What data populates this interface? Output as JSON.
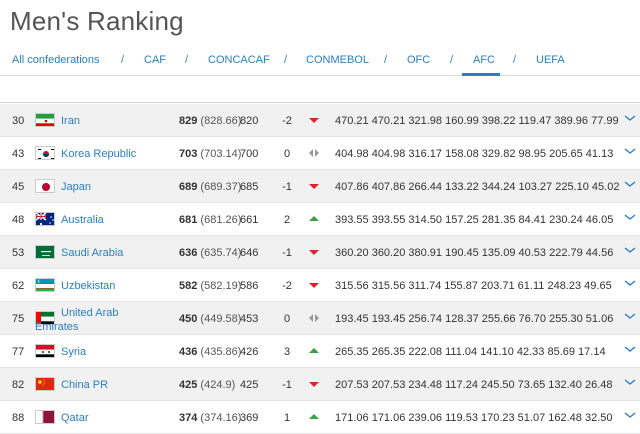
{
  "page": {
    "title": "Men's Ranking"
  },
  "tabs": [
    {
      "label": "All confederations",
      "active": false
    },
    {
      "label": "CAF",
      "active": false
    },
    {
      "label": "CONCACAF",
      "active": false
    },
    {
      "label": "CONMEBOL",
      "active": false
    },
    {
      "label": "OFC",
      "active": false
    },
    {
      "label": "AFC",
      "active": true
    },
    {
      "label": "UEFA",
      "active": false
    }
  ],
  "separator": "/",
  "colors": {
    "link": "#2a7fc0",
    "down": "#d9222a",
    "up": "#3aa146",
    "same": "#999999",
    "row_alt": "#f1f1f1"
  },
  "rows": [
    {
      "rank": "30",
      "country": "Iran",
      "flag": "iran-flag",
      "points": "829",
      "points_exact": "(828.66)",
      "previous": "820",
      "movement": "-2",
      "trend": "down",
      "values": "470.21 470.21 321.98 160.99 398.22 119.47 389.96 77.99"
    },
    {
      "rank": "43",
      "country": "Korea Republic",
      "flag": "korea-republic-flag",
      "points": "703",
      "points_exact": "(703.14)",
      "previous": "700",
      "movement": "0",
      "trend": "same",
      "values": "404.98 404.98 316.17 158.08 329.82 98.95 205.65 41.13"
    },
    {
      "rank": "45",
      "country": "Japan",
      "flag": "japan-flag",
      "points": "689",
      "points_exact": "(689.37)",
      "previous": "685",
      "movement": "-1",
      "trend": "down",
      "values": "407.86 407.86 266.44 133.22 344.24 103.27 225.10 45.02"
    },
    {
      "rank": "48",
      "country": "Australia",
      "flag": "australia-flag",
      "points": "681",
      "points_exact": "(681.26)",
      "previous": "661",
      "movement": "2",
      "trend": "up",
      "values": "393.55 393.55 314.50 157.25 281.35 84.41 230.24 46.05"
    },
    {
      "rank": "53",
      "country": "Saudi Arabia",
      "flag": "saudi-arabia-flag",
      "points": "636",
      "points_exact": "(635.74)",
      "previous": "646",
      "movement": "-1",
      "trend": "down",
      "values": "360.20 360.20 380.91 190.45 135.09 40.53 222.79 44.56"
    },
    {
      "rank": "62",
      "country": "Uzbekistan",
      "flag": "uzbekistan-flag",
      "points": "582",
      "points_exact": "(582.19)",
      "previous": "586",
      "movement": "-2",
      "trend": "down",
      "values": "315.56 315.56 311.74 155.87 203.71 61.11 248.23 49.65"
    },
    {
      "rank": "75",
      "country_line1": "United Arab",
      "country_line2": "Emirates",
      "flag": "uae-flag",
      "points": "450",
      "points_exact": "(449.58)",
      "previous": "453",
      "movement": "0",
      "trend": "same",
      "values": "193.45 193.45 256.74 128.37 255.66 76.70 255.30 51.06"
    },
    {
      "rank": "77",
      "country": "Syria",
      "flag": "syria-flag",
      "points": "436",
      "points_exact": "(435.86)",
      "previous": "426",
      "movement": "3",
      "trend": "up",
      "values": "265.35 265.35 222.08 111.04 141.10 42.33  85.69 17.14"
    },
    {
      "rank": "82",
      "country": "China PR",
      "flag": "china-flag",
      "points": "425",
      "points_exact": "(424.9)",
      "previous": "425",
      "movement": "-1",
      "trend": "down",
      "values": "207.53 207.53 234.48 117.24 245.50 73.65 132.40 26.48"
    },
    {
      "rank": "88",
      "country": "Qatar",
      "flag": "qatar-flag",
      "points": "374",
      "points_exact": "(374.16)",
      "previous": "369",
      "movement": "1",
      "trend": "up",
      "values": "171.06 171.06 239.06 119.53 170.23 51.07 162.48 32.50"
    }
  ]
}
